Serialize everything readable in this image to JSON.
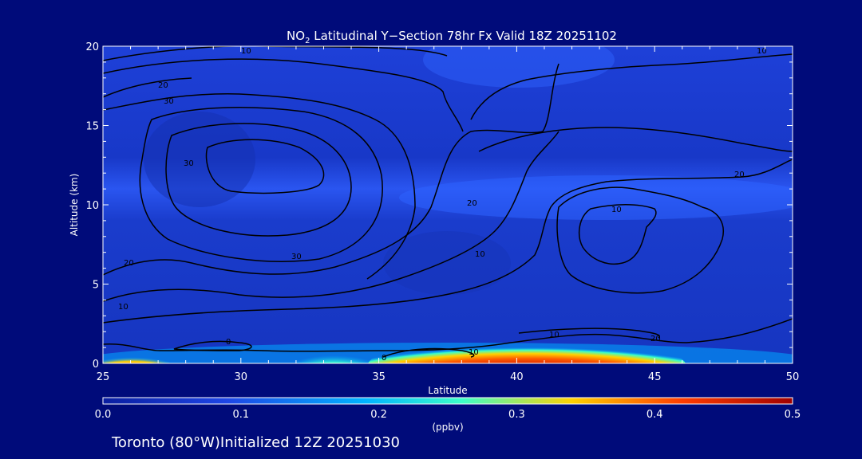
{
  "chart_data": {
    "type": "heatmap",
    "title_prefix": "NO",
    "title_sub": "2",
    "title_rest": " Latitudinal Y−Section 78hr  Fx Valid 18Z 20251102",
    "xlabel": "Latitude",
    "ylabel": "Altitude (km)",
    "xlim": [
      25,
      50
    ],
    "ylim": [
      0,
      20
    ],
    "x_ticks": [
      "25",
      "30",
      "35",
      "40",
      "45",
      "50"
    ],
    "y_ticks": [
      "0",
      "5",
      "10",
      "15",
      "20"
    ],
    "colorbar": {
      "range": [
        0.0,
        0.5
      ],
      "ticks": [
        "0.0",
        "0.1",
        "0.2",
        "0.3",
        "0.4",
        "0.5"
      ],
      "unit": "(ppbv)",
      "colors": [
        "#0a1ea0",
        "#1e46e6",
        "#00b4ff",
        "#3cffc8",
        "#ffd200",
        "#ff3c00",
        "#a00000"
      ]
    },
    "hotspots": [
      {
        "lat_range": [
          25,
          27.5
        ],
        "alt_range": [
          0,
          0.5
        ],
        "value": 0.45
      },
      {
        "lat_range": [
          32,
          34
        ],
        "alt_range": [
          0,
          0.6
        ],
        "value": 0.3
      },
      {
        "lat_range": [
          35.5,
          45.5
        ],
        "alt_range": [
          0,
          1.6
        ],
        "value": 0.5
      }
    ],
    "contour_labels": [
      "10",
      "20",
      "30",
      "30",
      "20",
      "10",
      "10",
      "20",
      "20",
      "30",
      "10",
      "0",
      "10",
      "0",
      "10",
      "10",
      "20"
    ]
  },
  "footer": {
    "location": "Toronto (80°W)",
    "initialized": "Initialized 12Z 20251030"
  }
}
